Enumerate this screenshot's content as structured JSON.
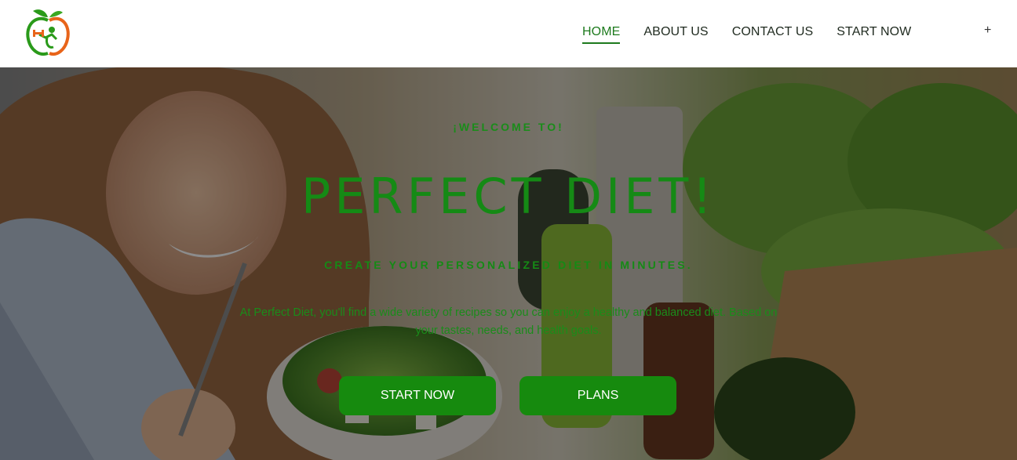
{
  "header": {
    "logo_icon": "apple-fitness-logo",
    "nav": [
      {
        "label": "HOME",
        "active": true
      },
      {
        "label": "ABOUT US",
        "active": false
      },
      {
        "label": "CONTACT US",
        "active": false
      },
      {
        "label": "START NOW",
        "active": false
      }
    ],
    "expand_icon": "plus-icon",
    "expand_label": "+"
  },
  "hero": {
    "welcome": "¡WELCOME TO!",
    "title": "PERFECT DIET!",
    "subtitle": "CREATE YOUR PERSONALIZED DIET IN MINUTES.",
    "description": "At Perfect Diet, you'll find a wide variety of recipes so you can enjoy a healthy and balanced diet. Based on your tastes, needs, and health goals.",
    "buttons": {
      "start": "START NOW",
      "plans": "PLANS"
    }
  },
  "colors": {
    "brand_green": "#168a0e",
    "nav_active": "#1d7a1d",
    "accent_orange": "#e8641a"
  }
}
